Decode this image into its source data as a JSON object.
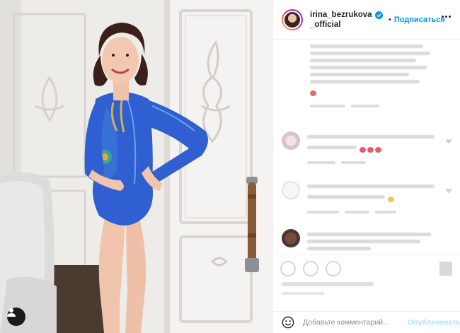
{
  "post": {
    "username_line1": "irina_bezrukova",
    "username_line2": "_official",
    "separator": "•",
    "follow_label": "Подписаться",
    "more_icon": "more-horizontal-icon",
    "verified_icon": "verified-badge-icon"
  },
  "comment_box": {
    "placeholder": "Добавьте комментарий...",
    "post_label": "Опубликовать",
    "emoji_icon": "smiley-icon"
  },
  "photo": {
    "tag_icon": "user-tag-icon"
  },
  "colors": {
    "accent": "#0095f6",
    "post_disabled": "#b2dffc",
    "border": "#efefef",
    "leotard": "#2f5fd0"
  }
}
